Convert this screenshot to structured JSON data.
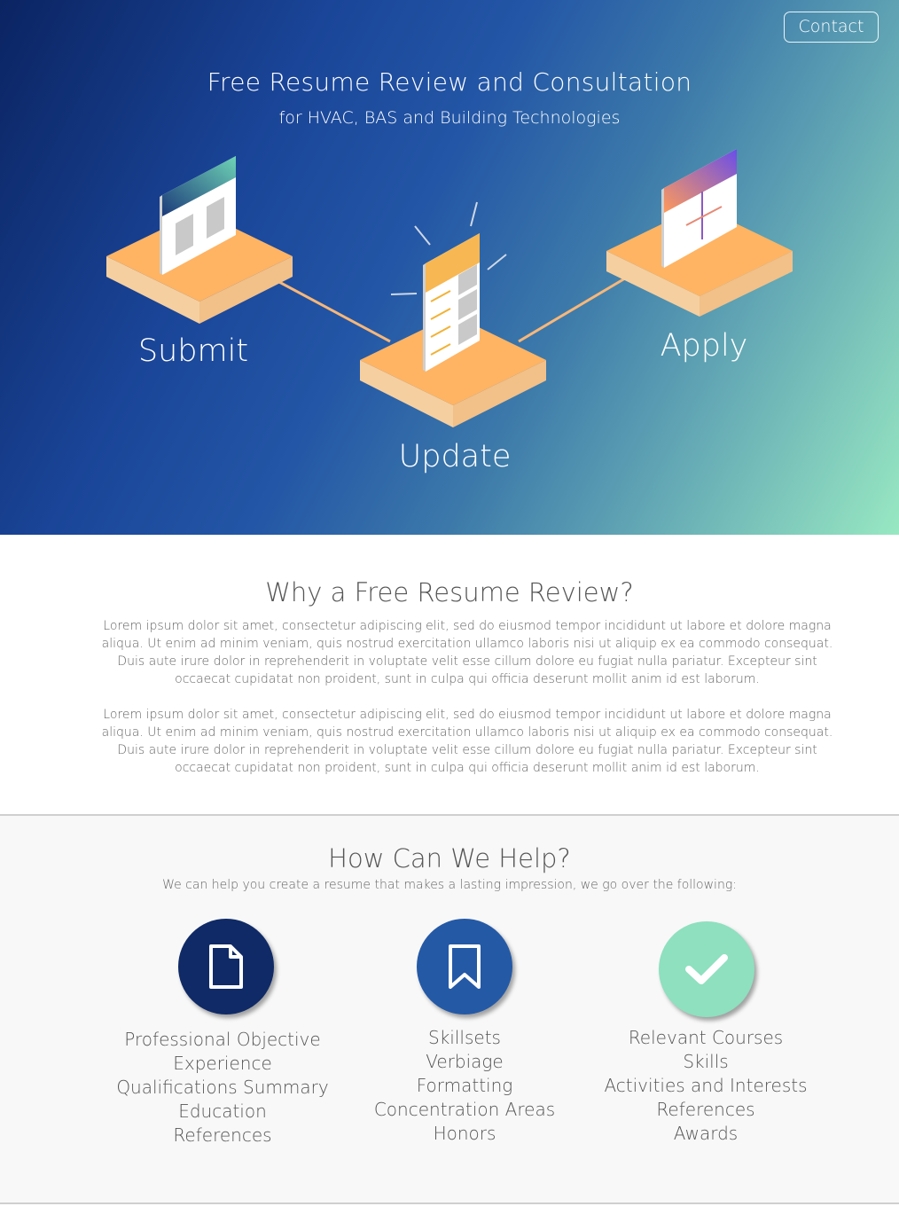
{
  "header": {
    "contact_label": "Contact",
    "title": "Free Resume Review and Consultation",
    "subtitle": "for HVAC, BAS and Building Technologies"
  },
  "steps": [
    {
      "label": "Submit",
      "icon": "document-layout-icon"
    },
    {
      "label": "Update",
      "icon": "document-edit-icon"
    },
    {
      "label": "Apply",
      "icon": "document-plus-icon"
    }
  ],
  "why": {
    "title": "Why a Free Resume Review?",
    "paragraphs": [
      "Lorem ipsum dolor sit amet, consectetur adipiscing elit, sed do eiusmod tempor incididunt ut labore et dolore magna aliqua. Ut enim ad minim veniam, quis nostrud exercitation ullamco laboris nisi ut aliquip ex ea commodo consequat. Duis aute irure dolor in reprehenderit in voluptate velit esse cillum dolore eu fugiat nulla pariatur. Excepteur sint occaecat cupidatat non proident, sunt in culpa qui officia deserunt mollit anim id est laborum.",
      "Lorem ipsum dolor sit amet, consectetur adipiscing elit, sed do eiusmod tempor incididunt ut labore et dolore magna aliqua. Ut enim ad minim veniam, quis nostrud exercitation ullamco laboris nisi ut aliquip ex ea commodo consequat. Duis aute irure dolor in reprehenderit in voluptate velit esse cillum dolore eu fugiat nulla pariatur. Excepteur sint occaecat cupidatat non proident, sunt in culpa qui officia deserunt mollit anim id est laborum."
    ]
  },
  "help": {
    "title": "How Can We Help?",
    "intro": "We can help you create a resume that makes a lasting impression, we go over the following:",
    "columns": [
      {
        "icon": "file-icon",
        "color": "#0f2a66",
        "items": [
          "Professional Objective",
          "Experience",
          "Qualifications Summary",
          "Education",
          "References"
        ]
      },
      {
        "icon": "bookmark-icon",
        "color": "#2459a6",
        "items": [
          "Skillsets",
          "Verbiage",
          "Formatting",
          "Concentration Areas",
          "Honors"
        ]
      },
      {
        "icon": "checkmark-icon",
        "color": "#8ee0bf",
        "items": [
          "Relevant Courses",
          "Skills",
          "Activities and Interests",
          "References",
          "Awards"
        ]
      }
    ]
  },
  "colors": {
    "platform_top": "#ffb463",
    "platform_side": "#f5cfa0",
    "connector": "#f7b77a"
  }
}
